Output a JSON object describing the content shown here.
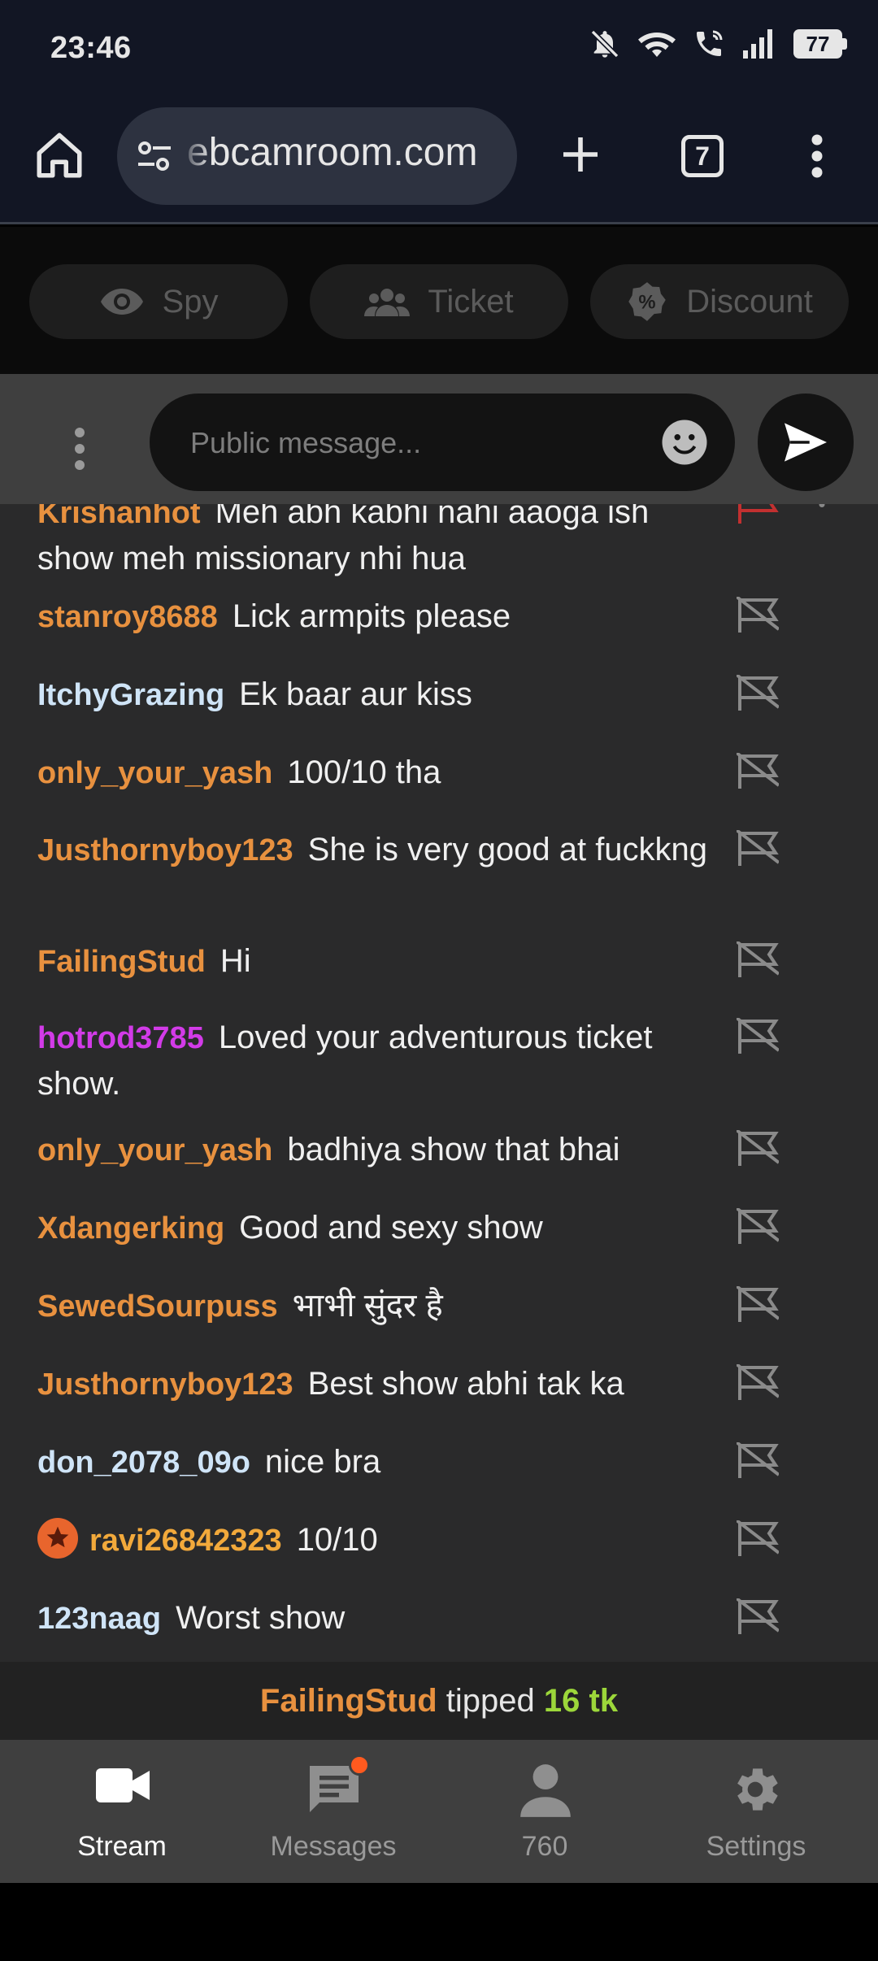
{
  "status_bar": {
    "time": "23:46",
    "battery": "77"
  },
  "browser": {
    "url": "ebcamroom.com",
    "tab_count": "7"
  },
  "actions": [
    {
      "label": "Spy",
      "icon": "eye-icon"
    },
    {
      "label": "Ticket",
      "icon": "group-icon"
    },
    {
      "label": "Discount",
      "icon": "percent-badge-icon"
    }
  ],
  "composer": {
    "placeholder": "Public message..."
  },
  "chat": {
    "messages": [
      {
        "user": "Krishanhot",
        "text": "Meh abh kabhi nahi aaoga ish show meh missionary nhi hua",
        "user_color": "#e8913f"
      },
      {
        "user": "stanroy8688",
        "text": "Lick armpits please",
        "user_color": "#e8913f"
      },
      {
        "user": "ItchyGrazing",
        "text": "Ek baar aur kiss",
        "user_color": "#cfe4f7"
      },
      {
        "user": "only_your_yash",
        "text": "100/10 tha",
        "user_color": "#e8913f"
      },
      {
        "user": "Justhornyboy123",
        "text": "She is very good at fuckkng",
        "user_color": "#e8913f"
      },
      {
        "user": "FailingStud",
        "text": "Hi",
        "user_color": "#e8913f"
      },
      {
        "user": "hotrod3785",
        "text": "Loved your adventurous ticket show.",
        "user_color": "#d23be8"
      },
      {
        "user": "only_your_yash",
        "text": "badhiya show that bhai",
        "user_color": "#e8913f"
      },
      {
        "user": "Xdangerking",
        "text": "Good and sexy show",
        "user_color": "#e8913f"
      },
      {
        "user": "SewedSourpuss",
        "text": "भाभी सुंदर है",
        "user_color": "#e8913f"
      },
      {
        "user": "Justhornyboy123",
        "text": "Best show abhi tak ka",
        "user_color": "#e8913f"
      },
      {
        "user": "don_2078_09o",
        "text": "nice bra",
        "user_color": "#cfe4f7"
      },
      {
        "user": "ravi26842323",
        "text": "10/10",
        "user_color": "#f2a93b"
      },
      {
        "user": "123naag",
        "text": "Worst show",
        "user_color": "#cfe4f7"
      }
    ]
  },
  "tip": {
    "user": "FailingStud",
    "verb": "tipped",
    "amount": "16 tk"
  },
  "nav": [
    {
      "label": "Stream",
      "icon": "videocam-icon",
      "active": true
    },
    {
      "label": "Messages",
      "icon": "chat-icon"
    },
    {
      "label": "760",
      "icon": "person-icon"
    },
    {
      "label": "Settings",
      "icon": "gear-icon"
    }
  ]
}
